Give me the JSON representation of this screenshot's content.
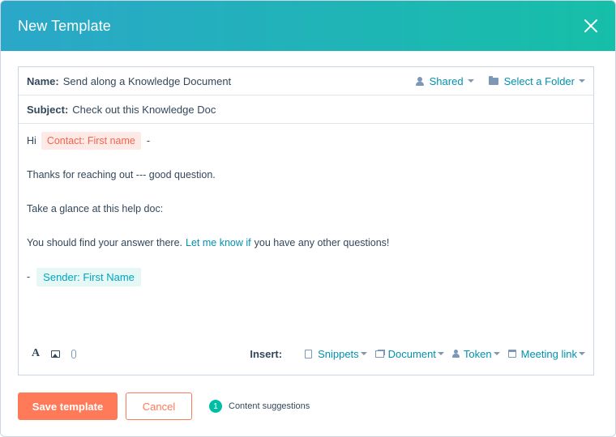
{
  "modal": {
    "title": "New Template",
    "close_icon": "close-icon"
  },
  "fields": {
    "name_label": "Name:",
    "name_value": "Send along a Knowledge Document",
    "shared_label": "Shared",
    "folder_label": "Select a Folder",
    "subject_label": "Subject:",
    "subject_value": "Check out this Knowledge Doc"
  },
  "body": {
    "greeting": "Hi",
    "contact_token": "Contact: First name",
    "greeting_tail": "-",
    "line1": "Thanks for reaching out --- good question.",
    "line2": "Take a glance at this help doc:",
    "line3_before": "You should find your answer there.",
    "line3_link": "Let me know if",
    "line3_after": "you have any other questions!",
    "signoff_dash": "-",
    "sender_token": "Sender: First Name"
  },
  "toolbar": {
    "text_icon": "A",
    "insert_label": "Insert:",
    "snippets": "Snippets",
    "document": "Document",
    "token": "Token",
    "meeting_link": "Meeting link"
  },
  "footer": {
    "save_label": "Save template",
    "cancel_label": "Cancel",
    "suggestion_count": "1",
    "suggestion_label": "Content suggestions"
  },
  "colors": {
    "header_gradient_start": "#2ba7c9",
    "header_gradient_end": "#16bfa8",
    "primary": "#ff7a59",
    "link": "#0091ae",
    "badge": "#00bda5"
  }
}
